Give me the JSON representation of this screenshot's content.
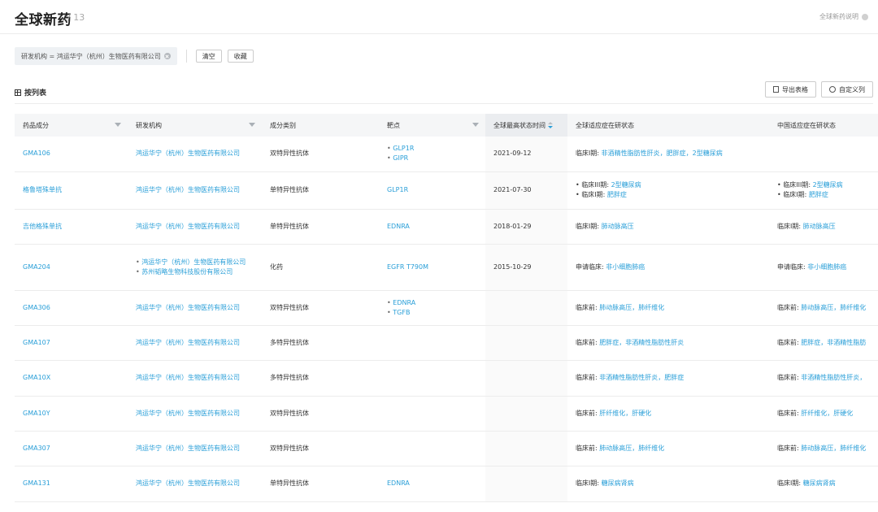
{
  "page": {
    "title": "全球新药",
    "count": "/ 13",
    "help_label": "全球新药说明"
  },
  "filter": {
    "chip_label": "研发机构 = 鸿运华宁（杭州）生物医药有限公司",
    "clear_label": "清空",
    "favorite_label": "收藏"
  },
  "view": {
    "label": "按列表",
    "export_label": "导出表格",
    "custom_label": "自定义列"
  },
  "table": {
    "headers": {
      "drug": "药品成分",
      "org": "研发机构",
      "type": "成分类别",
      "target": "靶点",
      "time": "全球最高状态时间",
      "global": "全球适应症在研状态",
      "china": "中国适应症在研状态"
    },
    "rows": [
      {
        "drug": "GMA106",
        "org": [
          "鸿运华宁（杭州）生物医药有限公司"
        ],
        "type": "双特异性抗体",
        "target": [
          "GLP1R",
          "GIPR"
        ],
        "time": "2021-09-12",
        "global": [
          {
            "phase": "临床I期:",
            "text": "非酒精性脂肪性肝炎，肥胖症，2型糖尿病"
          }
        ],
        "china": []
      },
      {
        "drug": "格鲁塔殊单抗",
        "org": [
          "鸿运华宁（杭州）生物医药有限公司"
        ],
        "type": "单特异性抗体",
        "target": [
          "GLP1R"
        ],
        "time": "2021-07-30",
        "global": [
          {
            "phase": "• 临床III期:",
            "text": "2型糖尿病"
          },
          {
            "phase": "• 临床I期:",
            "text": "肥胖症"
          }
        ],
        "china": [
          {
            "phase": "• 临床III期:",
            "text": "2型糖尿病"
          },
          {
            "phase": "• 临床I期:",
            "text": "肥胖症"
          }
        ]
      },
      {
        "drug": "吉他格殊单抗",
        "org": [
          "鸿运华宁（杭州）生物医药有限公司"
        ],
        "type": "单特异性抗体",
        "target": [
          "EDNRA"
        ],
        "time": "2018-01-29",
        "global": [
          {
            "phase": "临床I期:",
            "text": "肺动脉高压"
          }
        ],
        "china": [
          {
            "phase": "临床I期:",
            "text": "肺动脉高压"
          }
        ]
      },
      {
        "drug": "GMA204",
        "org": [
          "鸿运华宁（杭州）生物医药有限公司",
          "苏州韬略生物科技股份有限公司"
        ],
        "type": "化药",
        "target": [
          "EGFR T790M"
        ],
        "time": "2015-10-29",
        "global": [
          {
            "phase": "申请临床:",
            "text": "非小细胞肺癌"
          }
        ],
        "china": [
          {
            "phase": "申请临床:",
            "text": "非小细胞肺癌"
          }
        ]
      },
      {
        "drug": "GMA306",
        "org": [
          "鸿运华宁（杭州）生物医药有限公司"
        ],
        "type": "双特异性抗体",
        "target": [
          "EDNRA",
          "TGFB"
        ],
        "time": "",
        "global": [
          {
            "phase": "临床前:",
            "text": "肺动脉高压，肺纤维化"
          }
        ],
        "china": [
          {
            "phase": "临床前:",
            "text": "肺动脉高压，肺纤维化"
          }
        ]
      },
      {
        "drug": "GMA107",
        "org": [
          "鸿运华宁（杭州）生物医药有限公司"
        ],
        "type": "多特异性抗体",
        "target": [],
        "time": "",
        "global": [
          {
            "phase": "临床前:",
            "text": "肥胖症，非酒精性脂肪性肝炎"
          }
        ],
        "china": [
          {
            "phase": "临床前:",
            "text": "肥胖症，非酒精性脂肪"
          }
        ]
      },
      {
        "drug": "GMA10X",
        "org": [
          "鸿运华宁（杭州）生物医药有限公司"
        ],
        "type": "多特异性抗体",
        "target": [],
        "time": "",
        "global": [
          {
            "phase": "临床前:",
            "text": "非酒精性脂肪性肝炎，肥胖症"
          }
        ],
        "china": [
          {
            "phase": "临床前:",
            "text": "非酒精性脂肪性肝炎，"
          }
        ]
      },
      {
        "drug": "GMA10Y",
        "org": [
          "鸿运华宁（杭州）生物医药有限公司"
        ],
        "type": "双特异性抗体",
        "target": [],
        "time": "",
        "global": [
          {
            "phase": "临床前:",
            "text": "肝纤维化，肝硬化"
          }
        ],
        "china": [
          {
            "phase": "临床前:",
            "text": "肝纤维化，肝硬化"
          }
        ]
      },
      {
        "drug": "GMA307",
        "org": [
          "鸿运华宁（杭州）生物医药有限公司"
        ],
        "type": "双特异性抗体",
        "target": [],
        "time": "",
        "global": [
          {
            "phase": "临床前:",
            "text": "肺动脉高压，肺纤维化"
          }
        ],
        "china": [
          {
            "phase": "临床前:",
            "text": "肺动脉高压，肺纤维化"
          }
        ]
      },
      {
        "drug": "GMA131",
        "org": [
          "鸿运华宁（杭州）生物医药有限公司"
        ],
        "type": "单特异性抗体",
        "target": [
          "EDNRA"
        ],
        "time": "",
        "global": [
          {
            "phase": "临床I期:",
            "text": "糖尿病肾病"
          }
        ],
        "china": [
          {
            "phase": "临床I期:",
            "text": "糖尿病肾病"
          }
        ]
      }
    ]
  }
}
